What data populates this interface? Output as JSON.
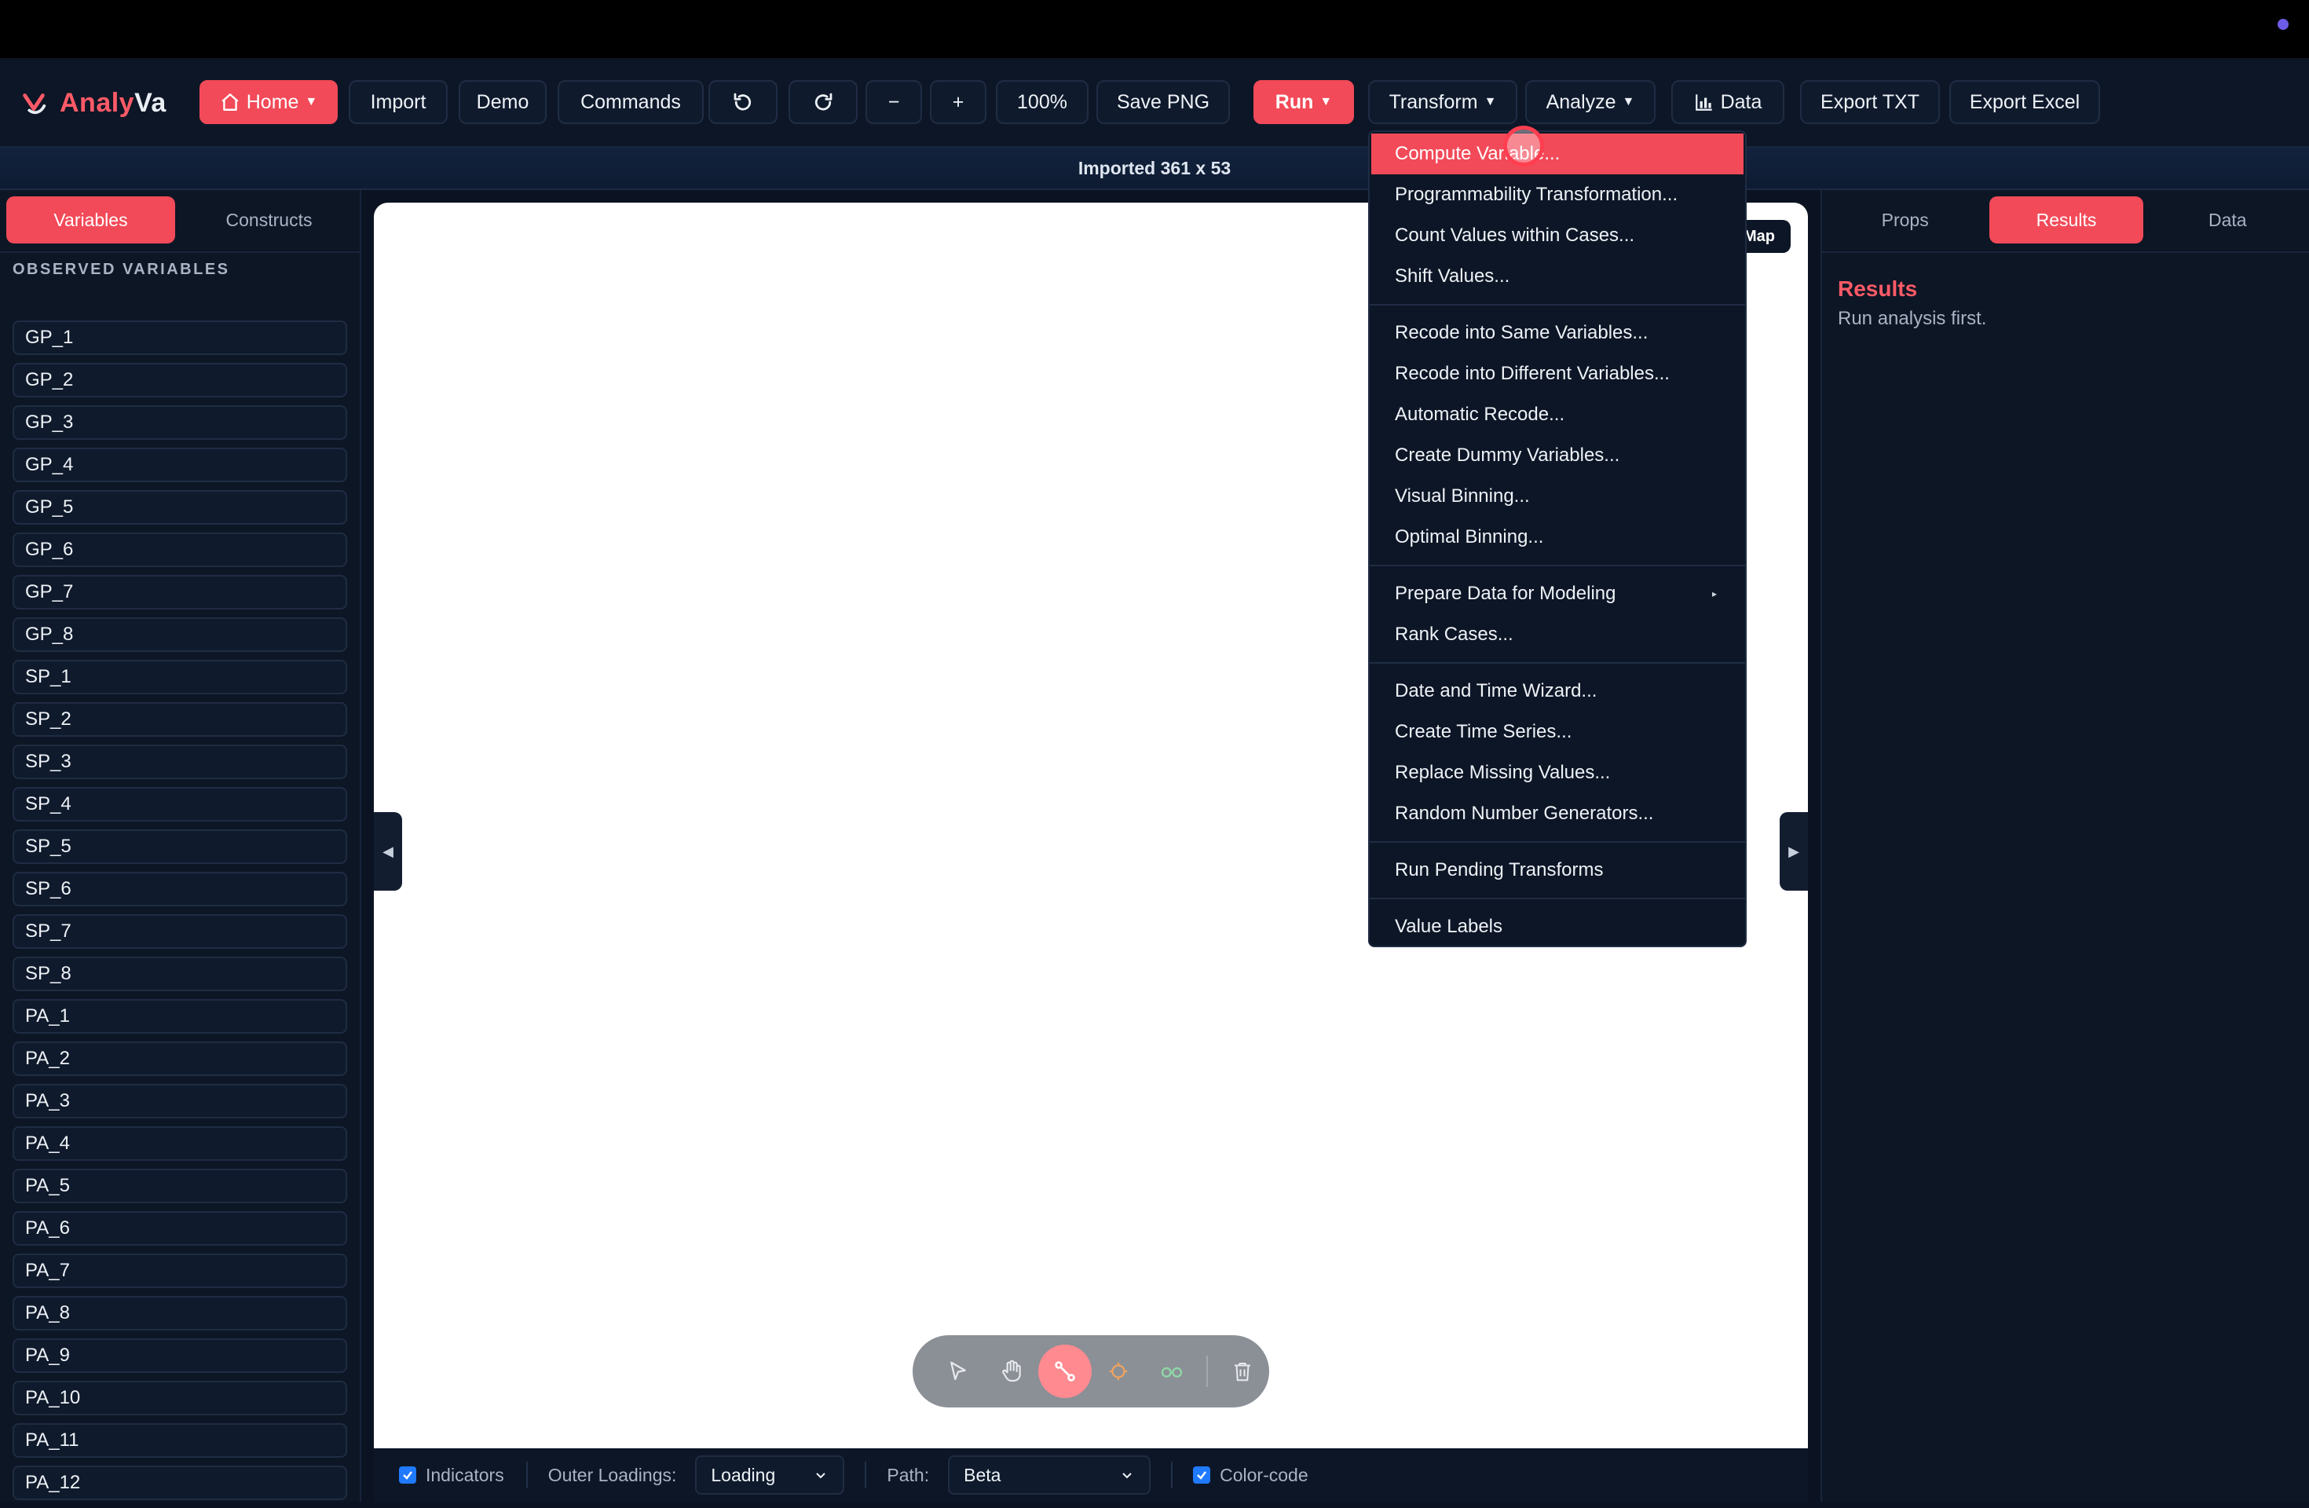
{
  "app": {
    "name_part1": "Analy",
    "name_part2": "Va"
  },
  "toolbar": {
    "home": "Home",
    "import": "Import",
    "demo": "Demo",
    "commands": "Commands",
    "zoom_out": "−",
    "zoom_in": "+",
    "zoom_level": "100%",
    "save_png": "Save PNG",
    "run": "Run",
    "transform": "Transform",
    "analyze": "Analyze",
    "data": "Data",
    "export_txt": "Export TXT",
    "export_excel": "Export Excel"
  },
  "banner": "Imported 361 x 53",
  "left_panel": {
    "tabs": [
      "Variables",
      "Constructs"
    ],
    "active_tab": "Variables",
    "section_title": "OBSERVED VARIABLES",
    "variables": [
      "GP_1",
      "GP_2",
      "GP_3",
      "GP_4",
      "GP_5",
      "GP_6",
      "GP_7",
      "GP_8",
      "SP_1",
      "SP_2",
      "SP_3",
      "SP_4",
      "SP_5",
      "SP_6",
      "SP_7",
      "SP_8",
      "PA_1",
      "PA_2",
      "PA_3",
      "PA_4",
      "PA_5",
      "PA_6",
      "PA_7",
      "PA_8",
      "PA_9",
      "PA_10",
      "PA_11",
      "PA_12"
    ]
  },
  "canvas": {
    "map_badge": "Map"
  },
  "bottom_bar": {
    "indicators_label": "Indicators",
    "indicators_checked": true,
    "outer_loadings_label": "Outer Loadings:",
    "outer_loadings_value": "Loading",
    "path_label": "Path:",
    "path_value": "Beta",
    "color_code_label": "Color-code",
    "color_code_checked": true
  },
  "right_panel": {
    "tabs": [
      "Props",
      "Results",
      "Data"
    ],
    "active_tab": "Results",
    "results_title": "Results",
    "results_message": "Run analysis first."
  },
  "transform_menu": {
    "groups": [
      [
        "Compute Variable...",
        "Programmability Transformation...",
        "Count Values within Cases...",
        "Shift Values..."
      ],
      [
        "Recode into Same Variables...",
        "Recode into Different Variables...",
        "Automatic Recode...",
        "Create Dummy Variables...",
        "Visual Binning...",
        "Optimal Binning..."
      ],
      [
        "Prepare Data for Modeling",
        "Rank Cases..."
      ],
      [
        "Date and Time Wizard...",
        "Create Time Series...",
        "Replace Missing Values...",
        "Random Number Generators..."
      ],
      [
        "Run Pending Transforms"
      ],
      [
        "Value Labels"
      ]
    ],
    "highlighted": "Compute Variable..."
  },
  "colors": {
    "accent": "#f24a58",
    "background": "#0b1322",
    "panel": "#0d1625",
    "checkbox": "#1f7aff"
  }
}
